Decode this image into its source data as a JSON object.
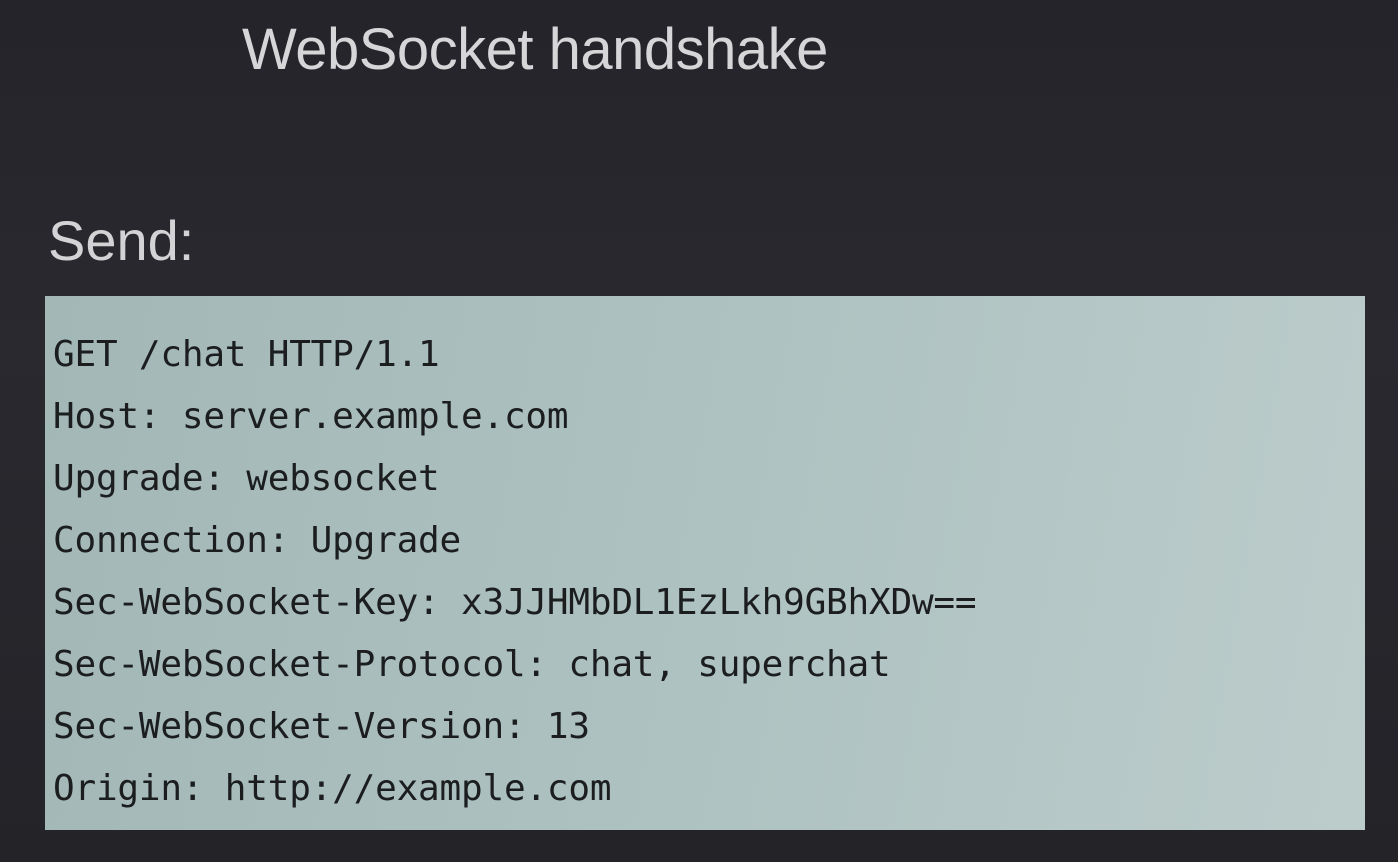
{
  "slide": {
    "title": "WebSocket handshake",
    "send_label": "Send:",
    "request_lines": [
      "GET /chat HTTP/1.1",
      "Host: server.example.com",
      "Upgrade: websocket",
      "Connection: Upgrade",
      "Sec-WebSocket-Key: x3JJHMbDL1EzLkh9GBhXDw==",
      "Sec-WebSocket-Protocol: chat, superchat",
      "Sec-WebSocket-Version: 13",
      "Origin: http://example.com"
    ]
  },
  "colors": {
    "background": "#25252b",
    "title_text": "#d6d6d9",
    "code_box": "#afc3c2",
    "code_text": "#1b1d1f"
  }
}
